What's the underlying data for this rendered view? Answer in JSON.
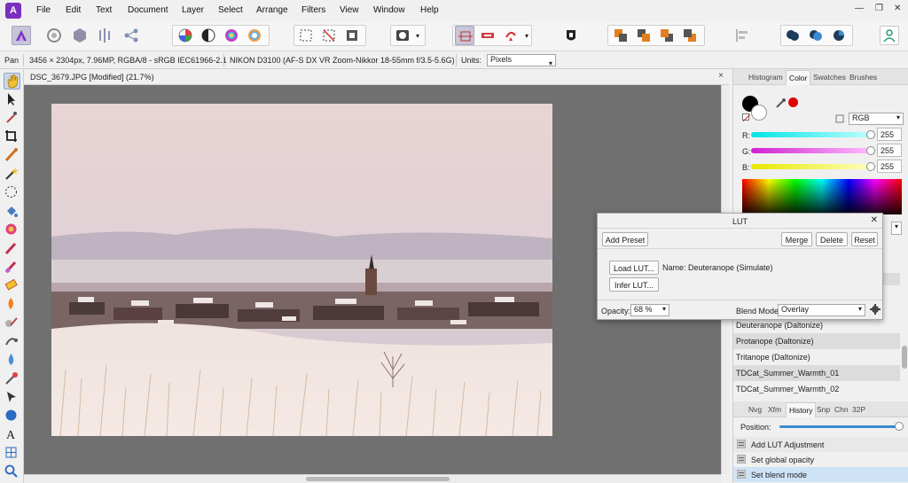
{
  "menu": [
    "File",
    "Edit",
    "Text",
    "Document",
    "Layer",
    "Select",
    "Arrange",
    "Filters",
    "View",
    "Window",
    "Help"
  ],
  "window_controls": {
    "minimize": "—",
    "maximize": "❐",
    "close": "✕"
  },
  "context_bar": {
    "tool_name": "Pan",
    "doc_info": "3456 × 2304px, 7.96MP, RGBA/8 - sRGB IEC61966-2.1",
    "camera_info": "NIKON D3100 (AF-S DX VR Zoom-Nikkor 18-55mm f/3.5-5.6G)",
    "units_label": "Units:",
    "units_value": "Pixels"
  },
  "document": {
    "tab_title": "DSC_3679.JPG [Modified] (21.7%)",
    "close": "×"
  },
  "right_panel": {
    "top_tabs": [
      "Histogram",
      "Color",
      "Swatches",
      "Brushes"
    ],
    "active_top_tab": "Color",
    "color_model": "RGB",
    "channels": [
      {
        "label": "R:",
        "value": "255",
        "color": "#00e0e0"
      },
      {
        "label": "G:",
        "value": "255",
        "color": "#e020e0"
      },
      {
        "label": "B:",
        "value": "255",
        "color": "#e8e800"
      }
    ],
    "lut_list": [
      "Deuteranope (Daltonize)",
      "Protanope (Daltonize)",
      "Tritanope (Daltonize)",
      "TDCat_Summer_Warmth_01",
      "TDCat_Summer_Warmth_02"
    ],
    "bottom_tabs": [
      "Nvg",
      "Xfm",
      "History",
      "Snp",
      "Chn",
      "32P"
    ],
    "active_bottom_tab": "History",
    "position_label": "Position:",
    "position_value": 1.0,
    "history": [
      "Add LUT Adjustment",
      "Set global opacity",
      "Set blend mode"
    ]
  },
  "lut_dialog": {
    "title": "LUT",
    "close": "✕",
    "add_preset": "Add Preset",
    "merge": "Merge",
    "delete": "Delete",
    "reset": "Reset",
    "load_lut": "Load LUT...",
    "lut_name": "Name: Deuteranope (Simulate)",
    "infer_lut": "Infer LUT...",
    "opacity_label": "Opacity:",
    "opacity_value": "68 %",
    "blend_label": "Blend Mode:",
    "blend_value": "Overlay"
  },
  "colors": {
    "accent": "#7b2fbe",
    "history_selected": "#cfe3f7",
    "canvas_bg": "#707070"
  }
}
